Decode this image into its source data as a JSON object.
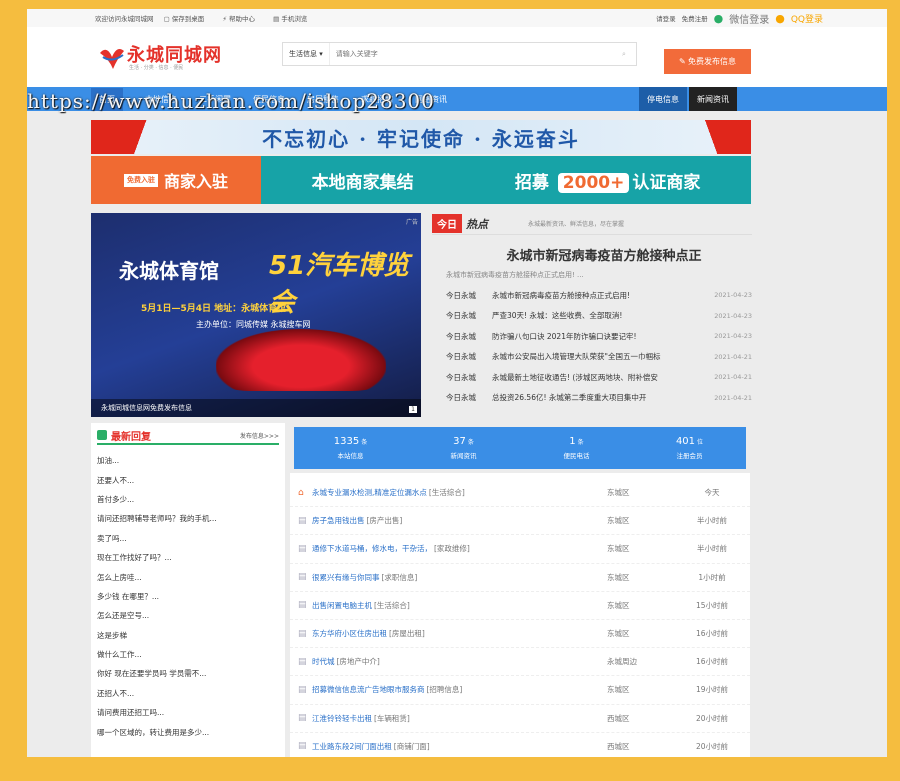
{
  "topbar": {
    "welcome": "欢迎访问永城同城网",
    "favorite": "保存到桌面",
    "help": "帮助中心",
    "mobile": "手机浏览",
    "login": "请登录",
    "register": "免费注册",
    "wechat_login": "微信登录",
    "qq_login": "QQ登录"
  },
  "header": {
    "logo_text": "永城同城网",
    "logo_sub": "生活 · 分类 · 信息 · 便民",
    "search_category": "生活信息",
    "search_placeholder": "请输入关键字",
    "post_button": "免费发布信息"
  },
  "nav": {
    "items": [
      "首页",
      "本地信息",
      "二手闲置",
      "便民信息",
      "房屋租售",
      "求职招聘",
      "网络资讯"
    ],
    "right": [
      "停电信息",
      "新闻资讯"
    ]
  },
  "watermark": "https://www.huzhan.com/ishop28300",
  "banner1": {
    "slogan": "不忘初心 · 牢记使命 · 永远奋斗"
  },
  "banner2": {
    "tag": "免费入驻",
    "merchant": "商家入驻",
    "local": "本地商家集结",
    "recruit": "招募",
    "count": "2000+",
    "certified": "认证商家"
  },
  "promo": {
    "ad": "广告",
    "title_a": "永城体育馆",
    "title_b": "51汽车博览会",
    "dates": "5月1日—5月4日  地址：永城体育馆",
    "organizer": "主办单位：同城传媒  永城搜车网",
    "caption": "永城同城信息网免费发布信息",
    "page": "1"
  },
  "hot": {
    "badge": "今日",
    "title": "热点",
    "subtitle": "永城最新资讯、鲜活信息，尽在掌握",
    "headline": "永城市新冠病毒疫苗方舱接种点正",
    "summary": "永城市新冠病毒疫苗方舱接种点正式启用! ...",
    "items": [
      {
        "src": "今日永城",
        "title": "永城市新冠病毒疫苗方舱接种点正式启用!",
        "date": "2021-04-23"
      },
      {
        "src": "今日永城",
        "title": "严查30天! 永城：这些收费、全部取消!",
        "date": "2021-04-23"
      },
      {
        "src": "今日永城",
        "title": "防诈骗八句口诀 2021年防诈骗口诀要记牢!",
        "date": "2021-04-23"
      },
      {
        "src": "今日永城",
        "title": "永城市公安局出入境管理大队荣获\"全国五一巾帼标",
        "date": "2021-04-21"
      },
      {
        "src": "今日永城",
        "title": "永城最新土地征收通告! (涉城区两地块、附补偿安",
        "date": "2021-04-21"
      },
      {
        "src": "今日永城",
        "title": "总投资26.56亿! 永城第二季度重大项目集中开",
        "date": "2021-04-21"
      }
    ]
  },
  "replies": {
    "title": "最新回复",
    "more": "发布信息>>>",
    "items": [
      "加油...",
      "还要人不...",
      "首付多少...",
      "请问还招聘辅导老师吗？我的手机...",
      "卖了吗...",
      "现在工作找好了吗？...",
      "怎么上房哇...",
      "多少钱 在哪里？...",
      "怎么还是空号...",
      "这是步梯",
      "做什么工作...",
      "你好 现在还要学员吗 学员需不...",
      "还招人不...",
      "请问费用还招工吗...",
      "哪一个区域的，转让费用是多少..."
    ]
  },
  "stats": [
    {
      "num": "1335",
      "unit": "条",
      "label": "本站信息"
    },
    {
      "num": "37",
      "unit": "条",
      "label": "新闻资讯"
    },
    {
      "num": "1",
      "unit": "条",
      "label": "便民电话"
    },
    {
      "num": "401",
      "unit": "位",
      "label": "注册会员"
    }
  ],
  "listings": [
    {
      "title": "永城专业漏水检测,精准定位漏水点",
      "cat": "[生活综合]",
      "area": "东城区",
      "time": "今天",
      "top": true
    },
    {
      "title": "房子急用钱出售",
      "cat": "[房产出售]",
      "area": "东城区",
      "time": "半小时前",
      "top": false
    },
    {
      "title": "通修下水道马桶，修水电，干杂活，",
      "cat": "[家政维修]",
      "area": "东城区",
      "time": "半小时前",
      "top": false
    },
    {
      "title": "很累兴有缘与你同事",
      "cat": "[求职信息]",
      "area": "东城区",
      "time": "1小时前",
      "top": false
    },
    {
      "title": "出售闲置电脑主机",
      "cat": "[生活综合]",
      "area": "东城区",
      "time": "15小时前",
      "top": false
    },
    {
      "title": "东方华府小区住房出租",
      "cat": "[房屋出租]",
      "area": "东城区",
      "time": "16小时前",
      "top": false
    },
    {
      "title": "时代城",
      "cat": "[房地产中介]",
      "area": "永城周边",
      "time": "16小时前",
      "top": false
    },
    {
      "title": "招募微信信息流广告地眼市服务商",
      "cat": "[招聘信息]",
      "area": "东城区",
      "time": "19小时前",
      "top": false
    },
    {
      "title": "江淮铃铃轻卡出租",
      "cat": "[车辆租赁]",
      "area": "西城区",
      "time": "20小时前",
      "top": false
    },
    {
      "title": "工业路东段2间门面出租",
      "cat": "[商铺门面]",
      "area": "西城区",
      "time": "20小时前",
      "top": false
    }
  ]
}
